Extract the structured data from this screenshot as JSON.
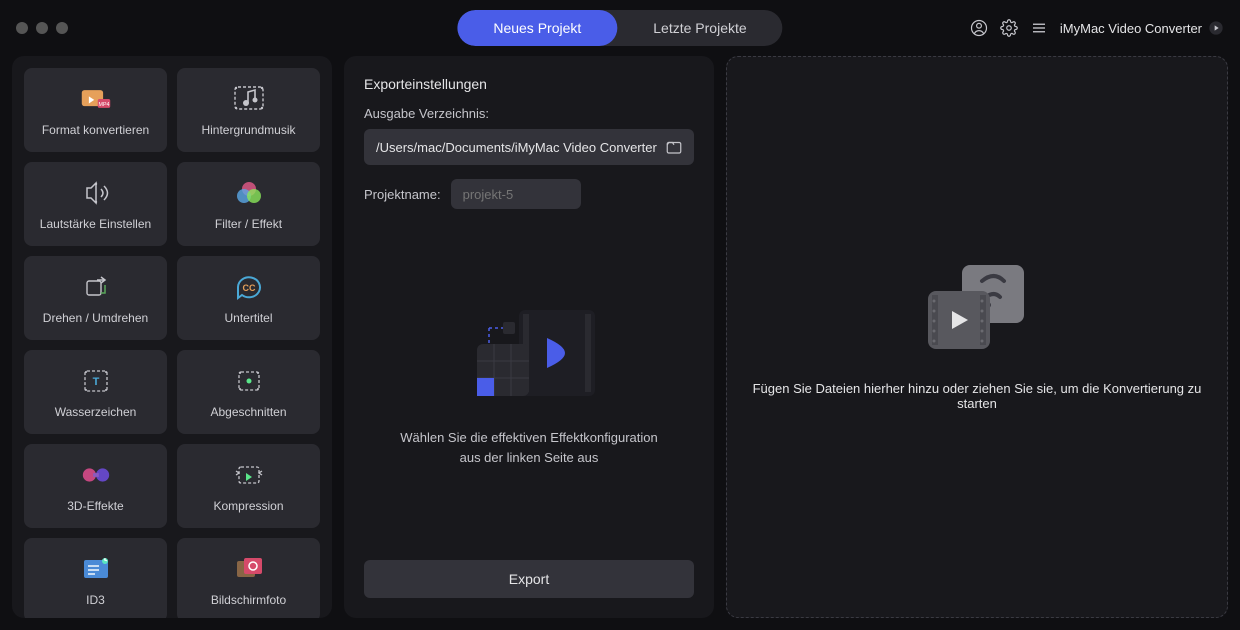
{
  "header": {
    "tabs": {
      "new": "Neues Projekt",
      "recent": "Letzte Projekte"
    },
    "app_title": "iMyMac Video Converter"
  },
  "sidebar": {
    "tools": [
      {
        "id": "format-convert",
        "label": "Format konvertieren"
      },
      {
        "id": "background-music",
        "label": "Hintergrundmusik"
      },
      {
        "id": "volume-adjust",
        "label": "Lautstärke Einstellen"
      },
      {
        "id": "filter-effect",
        "label": "Filter / Effekt"
      },
      {
        "id": "rotate-flip",
        "label": "Drehen / Umdrehen"
      },
      {
        "id": "subtitle",
        "label": "Untertitel"
      },
      {
        "id": "watermark",
        "label": "Wasserzeichen"
      },
      {
        "id": "crop",
        "label": "Abgeschnitten"
      },
      {
        "id": "3d-effects",
        "label": "3D-Effekte"
      },
      {
        "id": "compression",
        "label": "Kompression"
      },
      {
        "id": "id3",
        "label": "ID3"
      },
      {
        "id": "screenshot",
        "label": "Bildschirmfoto"
      }
    ]
  },
  "export": {
    "title": "Exporteinstellungen",
    "output_dir_label": "Ausgabe Verzeichnis:",
    "output_dir": "/Users/mac/Documents/iMyMac Video Converter",
    "project_label": "Projektname:",
    "project_name": "projekt-5",
    "help_text_1": "Wählen Sie die effektiven Effektkonfiguration",
    "help_text_2": "aus der linken Seite aus",
    "button": "Export"
  },
  "dropzone": {
    "text": "Fügen Sie Dateien hierher hinzu oder ziehen Sie sie, um die Konvertierung zu starten"
  }
}
